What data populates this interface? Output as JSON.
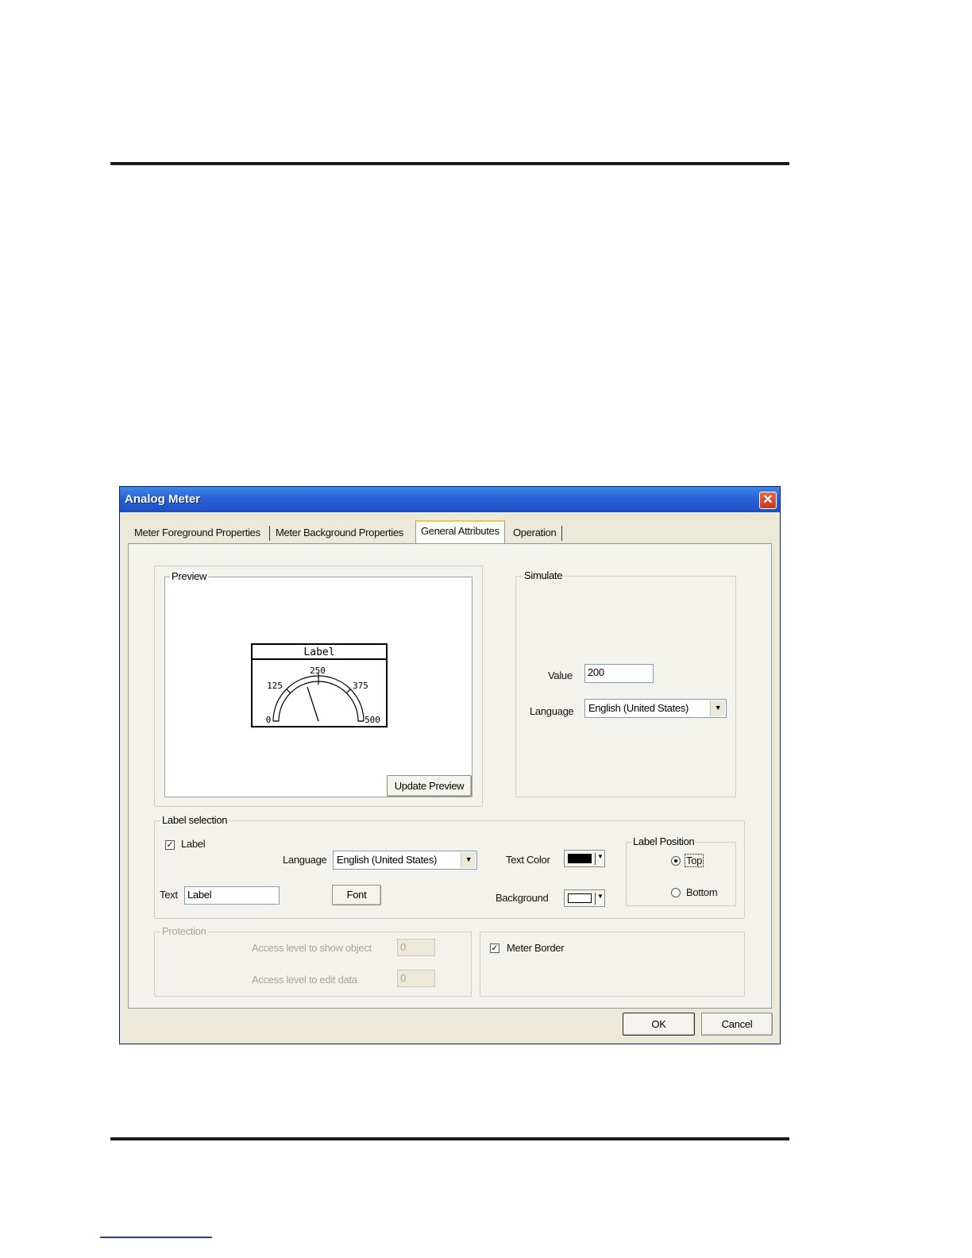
{
  "window": {
    "title": "Analog Meter",
    "close_glyph": "✕"
  },
  "tabs": [
    {
      "label": "Meter Foreground Properties",
      "active": false
    },
    {
      "label": "Meter Background Properties",
      "active": false
    },
    {
      "label": "General Attributes",
      "active": true
    },
    {
      "label": "Operation",
      "active": false
    }
  ],
  "preview": {
    "group_title": "Preview",
    "meter": {
      "label": "Label",
      "ticks": [
        "0",
        "125",
        "250",
        "375",
        "500"
      ],
      "min": 0,
      "max": 500,
      "value": 200
    },
    "update_button": "Update Preview"
  },
  "simulate": {
    "group_title": "Simulate",
    "value_label": "Value",
    "value": "200",
    "language_label": "Language",
    "language": "English (United States)"
  },
  "label_selection": {
    "group_title": "Label selection",
    "label_checkbox": "Label",
    "label_checked": true,
    "language_label": "Language",
    "language": "English (United States)",
    "text_label": "Text",
    "text_value": "Label",
    "font_button": "Font",
    "text_color_label": "Text Color",
    "text_color": "#000000",
    "background_label": "Background",
    "background_color": "#ffffff",
    "position_group_title": "Label Position",
    "position_top": "Top",
    "position_bottom": "Bottom",
    "position_selected": "Top"
  },
  "protection": {
    "group_title": "Protection",
    "show_label": "Access level to show object",
    "show_value": "0",
    "edit_label": "Access level to edit data",
    "edit_value": "0"
  },
  "meter_border": {
    "label": "Meter Border",
    "checked": true
  },
  "buttons": {
    "ok": "OK",
    "cancel": "Cancel"
  },
  "icons": {
    "close": "close-icon",
    "check": "checkmark-icon",
    "dropdown": "chevron-down-icon"
  }
}
